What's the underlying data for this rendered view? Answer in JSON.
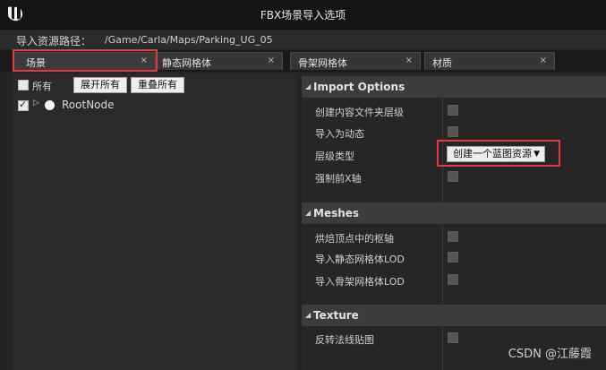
{
  "window": {
    "title": "FBX场景导入选项"
  },
  "path": {
    "label": "导入资源路径：",
    "value": "/Game/Carla/Maps/Parking_UG_05"
  },
  "tabs": [
    {
      "label": "场景",
      "close": "×"
    },
    {
      "label": "静态网格体",
      "close": "×"
    },
    {
      "label": "骨架网格体",
      "close": "×"
    },
    {
      "label": "材质",
      "close": "×"
    }
  ],
  "left": {
    "all_label": "所有",
    "expand_all": "展开所有",
    "collapse_all": "重叠所有",
    "tree": {
      "node": "RootNode"
    }
  },
  "sections": {
    "import_options": {
      "title": "Import Options",
      "rows": {
        "create_folder": "创建内容文件夹层级",
        "import_dynamic": "导入为动态",
        "hierarchy_type": "层级类型",
        "force_x": "强制前X轴"
      },
      "hierarchy_value": "创建一个蓝图资源"
    },
    "meshes": {
      "title": "Meshes",
      "rows": {
        "bake_pivot": "烘焙顶点中的枢轴",
        "import_static_lod": "导入静态网格体LOD",
        "import_skeletal_lod": "导入骨架网格体LOD"
      }
    },
    "texture": {
      "title": "Texture",
      "rows": {
        "invert_normal": "反转法线贴图"
      }
    }
  },
  "watermark": "CSDN @江藤霞",
  "colors": {
    "highlight": "#e33b3b",
    "background": "#242424"
  }
}
